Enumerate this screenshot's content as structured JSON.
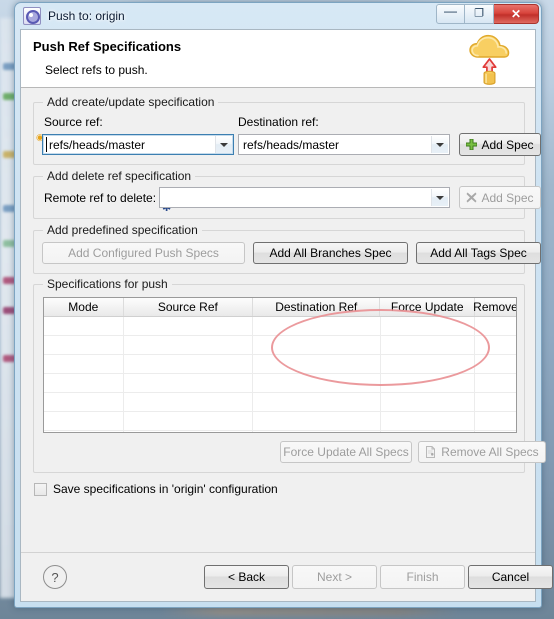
{
  "window": {
    "title": "Push to: origin",
    "icon": "git-push-gear-icon",
    "controls": {
      "minimize": "—",
      "maximize": "❐",
      "close": "✕"
    }
  },
  "header": {
    "title": "Push Ref Specifications",
    "description": "Select refs to push.",
    "icon": "cloud-upload-icon"
  },
  "groups": {
    "create_update": {
      "title": "Add create/update specification",
      "source_label": "Source ref:",
      "source_value": "refs/heads/master",
      "destination_label": "Destination ref:",
      "destination_value": "refs/heads/master",
      "add_spec_label": "Add Spec",
      "add_spec_icon": "green-plus-icon"
    },
    "delete_ref": {
      "title": "Add delete ref specification",
      "remote_label": "Remote ref to delete:",
      "remote_value": "",
      "add_spec_label": "Add Spec",
      "add_spec_icon": "gray-x-icon"
    },
    "predefined": {
      "title": "Add predefined specification",
      "configured_label": "Add Configured Push Specs",
      "all_branches_label": "Add All Branches Spec",
      "all_tags_label": "Add All Tags Spec"
    },
    "specifications": {
      "title": "Specifications for push",
      "columns": [
        "Mode",
        "Source Ref",
        "Destination Ref",
        "Force Update",
        "Remove"
      ],
      "rows": [],
      "empty_row_count": 7,
      "force_update_all_label": "Force Update All Specs",
      "remove_all_label": "Remove All Specs",
      "remove_all_icon": "remove-document-icon"
    }
  },
  "save_option": {
    "label": "Save specifications in 'origin' configuration",
    "checked": false
  },
  "footer": {
    "help_icon": "question-mark-icon",
    "buttons": [
      {
        "label": "< Back",
        "enabled": true
      },
      {
        "label": "Next >",
        "enabled": false
      },
      {
        "label": "Finish",
        "enabled": false
      },
      {
        "label": "Cancel",
        "enabled": true
      }
    ]
  },
  "annotation": {
    "shape": "ellipse",
    "color": "#e98f92"
  },
  "colors": {
    "accent": "#3c7fb1",
    "close_button": "#d8453c",
    "annotation": "#e98f92",
    "cloud": "#f5c44b",
    "arrow": "#e8393a"
  }
}
